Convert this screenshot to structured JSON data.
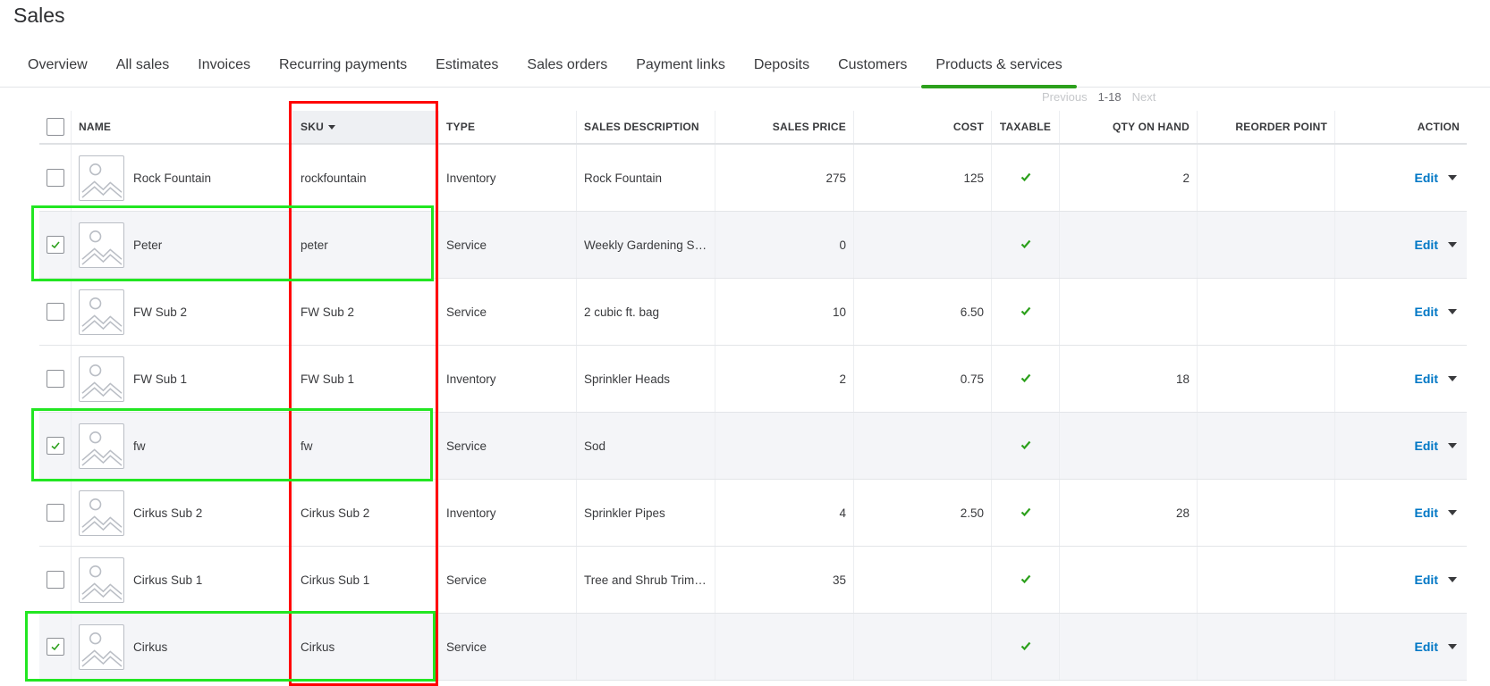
{
  "page": {
    "title": "Sales"
  },
  "tabs": [
    {
      "label": "Overview",
      "active": false
    },
    {
      "label": "All sales",
      "active": false
    },
    {
      "label": "Invoices",
      "active": false
    },
    {
      "label": "Recurring payments",
      "active": false
    },
    {
      "label": "Estimates",
      "active": false
    },
    {
      "label": "Sales orders",
      "active": false
    },
    {
      "label": "Payment links",
      "active": false
    },
    {
      "label": "Deposits",
      "active": false
    },
    {
      "label": "Customers",
      "active": false
    },
    {
      "label": "Products & services",
      "active": true
    }
  ],
  "pager": {
    "previous": "Previous",
    "range": "1-18",
    "next": "Next"
  },
  "table": {
    "headers": {
      "name": "NAME",
      "sku": "SKU",
      "type": "TYPE",
      "description": "SALES DESCRIPTION",
      "price": "SALES PRICE",
      "cost": "COST",
      "taxable": "TAXABLE",
      "qty": "QTY ON HAND",
      "reorder": "REORDER POINT",
      "action": "ACTION"
    },
    "sort_column": "sku",
    "edit_label": "Edit",
    "rows": [
      {
        "name": "Rock Fountain",
        "sku": "rockfountain",
        "type": "Inventory",
        "description": "Rock Fountain",
        "price": "275",
        "cost": "125",
        "taxable": true,
        "qty": "2",
        "reorder": "",
        "selected": false
      },
      {
        "name": "Peter",
        "sku": "peter",
        "type": "Service",
        "description": "Weekly Gardening S…",
        "price": "0",
        "cost": "",
        "taxable": true,
        "qty": "",
        "reorder": "",
        "selected": true
      },
      {
        "name": "FW Sub 2",
        "sku": "FW Sub 2",
        "type": "Service",
        "description": "2 cubic ft. bag",
        "price": "10",
        "cost": "6.50",
        "taxable": true,
        "qty": "",
        "reorder": "",
        "selected": false
      },
      {
        "name": "FW Sub 1",
        "sku": "FW Sub 1",
        "type": "Inventory",
        "description": "Sprinkler Heads",
        "price": "2",
        "cost": "0.75",
        "taxable": true,
        "qty": "18",
        "reorder": "",
        "selected": false
      },
      {
        "name": "fw",
        "sku": "fw",
        "type": "Service",
        "description": "Sod",
        "price": "",
        "cost": "",
        "taxable": true,
        "qty": "",
        "reorder": "",
        "selected": true
      },
      {
        "name": "Cirkus Sub 2",
        "sku": "Cirkus Sub 2",
        "type": "Inventory",
        "description": "Sprinkler Pipes",
        "price": "4",
        "cost": "2.50",
        "taxable": true,
        "qty": "28",
        "reorder": "",
        "selected": false
      },
      {
        "name": "Cirkus Sub 1",
        "sku": "Cirkus Sub 1",
        "type": "Service",
        "description": "Tree and Shrub Trim…",
        "price": "35",
        "cost": "",
        "taxable": true,
        "qty": "",
        "reorder": "",
        "selected": false
      },
      {
        "name": "Cirkus",
        "sku": "Cirkus",
        "type": "Service",
        "description": "",
        "price": "",
        "cost": "",
        "taxable": true,
        "qty": "",
        "reorder": "",
        "selected": true
      }
    ]
  },
  "colors": {
    "accent": "#2ca01c",
    "link": "#0077c5",
    "highlight_red": "#ff0000",
    "highlight_green": "#22e622"
  }
}
